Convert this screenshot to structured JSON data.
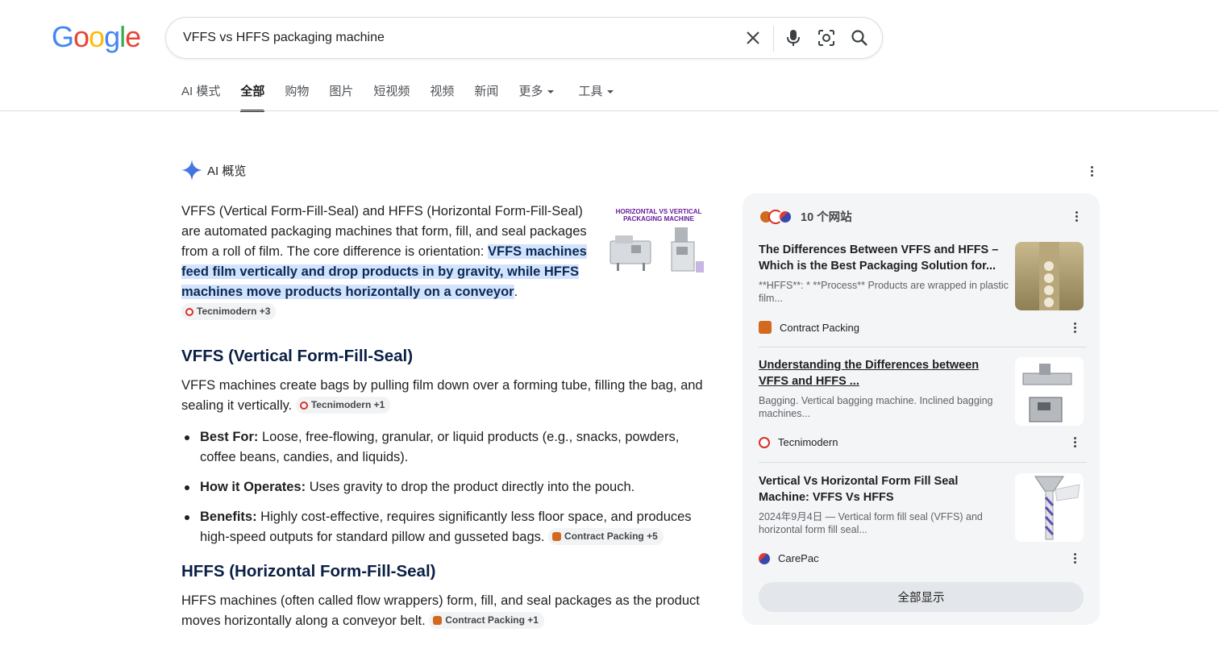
{
  "logo": "Google",
  "search": {
    "query": "VFFS vs HFFS packaging machine"
  },
  "icons": {
    "clear": "close-icon",
    "voice": "microphone-icon",
    "lens": "camera-lens-icon",
    "search": "search-icon",
    "ai": "sparkle-icon",
    "more": "more-vert-icon"
  },
  "tabs": [
    {
      "label": "AI 模式"
    },
    {
      "label": "全部",
      "active": true
    },
    {
      "label": "购物"
    },
    {
      "label": "图片"
    },
    {
      "label": "短视频"
    },
    {
      "label": "视频"
    },
    {
      "label": "新闻"
    },
    {
      "label": "更多"
    },
    {
      "label": "工具"
    }
  ],
  "ai_overview": {
    "title": "AI 概览",
    "intro_plain": "VFFS (Vertical Form-Fill-Seal) and HFFS (Horizontal Form-Fill-Seal) are automated packaging machines that form, fill, and seal packages from a roll of film. The core difference is orientation: ",
    "intro_highlight": "VFFS machines feed film vertically and drop products in by gravity, while HFFS machines move products horizontally on a conveyor",
    "intro_end": ".",
    "intro_chip": "Tecnimodern +3",
    "image_caption": "HORIZONTAL VS VERTICAL PACKAGING MACHINE",
    "vffs": {
      "heading": "VFFS (Vertical Form-Fill-Seal)",
      "text": "VFFS machines create bags by pulling film down over a forming tube, filling the bag, and sealing it vertically.",
      "chip": "Tecnimodern +1",
      "bullets": [
        {
          "label": "Best For:",
          "text": " Loose, free-flowing, granular, or liquid products (e.g., snacks, powders, coffee beans, candies, and liquids)."
        },
        {
          "label": "How it Operates:",
          "text": " Uses gravity to drop the product directly into the pouch."
        },
        {
          "label": "Benefits:",
          "text": " Highly cost-effective, requires significantly less floor space, and produces high-speed outputs for standard pillow and gusseted bags.",
          "chip": "Contract Packing +5"
        }
      ]
    },
    "hffs": {
      "heading": "HFFS (Horizontal Form-Fill-Seal)",
      "text": "HFFS machines (often called flow wrappers) form, fill, and seal packages as the product moves horizontally along a conveyor belt.",
      "chip": "Contract Packing +1"
    }
  },
  "sources": {
    "count_label": "10 个网站",
    "cards": [
      {
        "title": "The Differences Between VFFS and HFFS – Which is the Best Packaging Solution for...",
        "snippet": "**HFFS**: * **Process** Products are wrapped in plastic film...",
        "site": "Contract Packing"
      },
      {
        "title": "Understanding the Differences between VFFS and HFFS ...",
        "snippet": "Bagging. Vertical bagging machine. Inclined bagging machines...",
        "site": "Tecnimodern"
      },
      {
        "title": "Vertical Vs Horizontal Form Fill Seal Machine: VFFS Vs HFFS",
        "snippet": "2024年9月4日 — Vertical form fill seal (VFFS) and horizontal form fill seal...",
        "site": "CarePac"
      }
    ],
    "show_all": "全部显示"
  }
}
